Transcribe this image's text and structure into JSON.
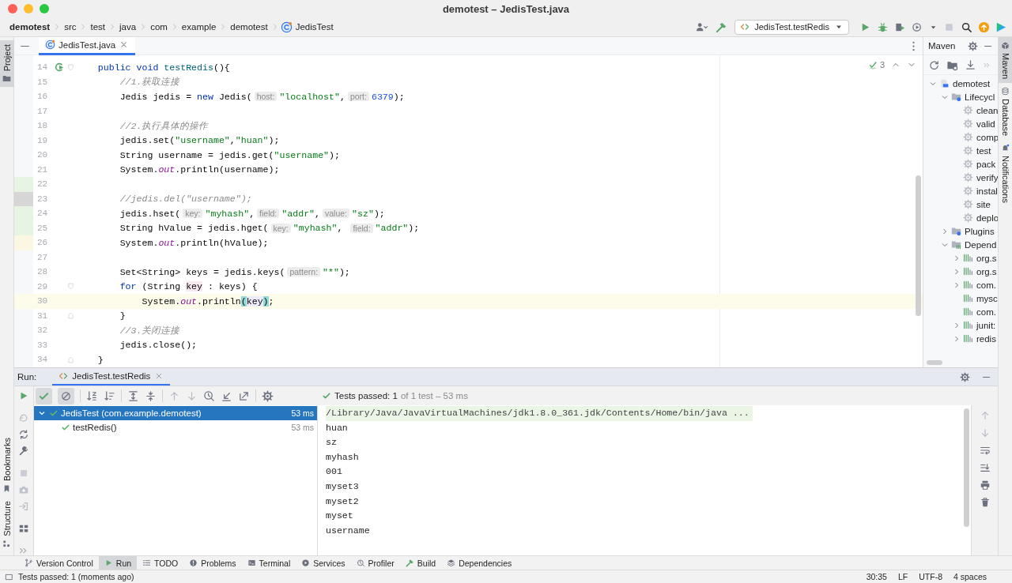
{
  "window": {
    "title": "demotest – JedisTest.java"
  },
  "breadcrumbs": [
    {
      "label": "demotest",
      "kind": "project"
    },
    {
      "label": "src",
      "kind": "folder"
    },
    {
      "label": "test",
      "kind": "folder"
    },
    {
      "label": "java",
      "kind": "folder"
    },
    {
      "label": "com",
      "kind": "folder"
    },
    {
      "label": "example",
      "kind": "folder"
    },
    {
      "label": "demotest",
      "kind": "folder"
    },
    {
      "label": "JedisTest",
      "kind": "class"
    }
  ],
  "run_config": {
    "label": "JedisTest.testRedis"
  },
  "left_stripe": [
    {
      "label": "Project",
      "selected": true
    },
    {
      "label": "Bookmarks",
      "selected": false
    },
    {
      "label": "Structure",
      "selected": false
    }
  ],
  "right_stripe": [
    {
      "label": "Maven",
      "selected": true
    },
    {
      "label": "Database",
      "selected": false
    },
    {
      "label": "Notifications",
      "selected": false
    }
  ],
  "editor": {
    "tabs": [
      {
        "label": "JedisTest.java",
        "selected": true
      }
    ],
    "inspection_count": "3",
    "lines": [
      {
        "number": "14",
        "current": false,
        "run_button": true,
        "fold_start": true,
        "tokens": [
          {
            "kind": "keyword",
            "text": "    public void"
          },
          {
            "kind": "method",
            "text": " testRedis"
          },
          {
            "kind": "plain",
            "text": "(){"
          }
        ]
      },
      {
        "number": "15",
        "current": false,
        "tokens": [
          {
            "kind": "comment",
            "text": "        //1.获取连接"
          }
        ]
      },
      {
        "number": "16",
        "current": false,
        "tokens": [
          {
            "kind": "plain",
            "text": "        Jedis jedis = "
          },
          {
            "kind": "keyword",
            "text": "new"
          },
          {
            "kind": "plain",
            "text": " Jedis("
          },
          {
            "kind": "hint",
            "text": "host:"
          },
          {
            "kind": "string",
            "text": "\"localhost\""
          },
          {
            "kind": "plain",
            "text": ","
          },
          {
            "kind": "hint",
            "text": "port:"
          },
          {
            "kind": "number",
            "text": "6379"
          },
          {
            "kind": "plain",
            "text": ");"
          }
        ]
      },
      {
        "number": "17",
        "current": false
      },
      {
        "number": "18",
        "current": false,
        "tokens": [
          {
            "kind": "comment",
            "text": "        //2.执行具体的操作"
          }
        ]
      },
      {
        "number": "19",
        "current": false,
        "tokens": [
          {
            "kind": "plain",
            "text": "        jedis.set("
          },
          {
            "kind": "string",
            "text": "\"username\""
          },
          {
            "kind": "plain",
            "text": ","
          },
          {
            "kind": "string",
            "text": "\"huan\""
          },
          {
            "kind": "plain",
            "text": ");"
          }
        ]
      },
      {
        "number": "20",
        "current": false,
        "tokens": [
          {
            "kind": "plain",
            "text": "        String username = jedis.get("
          },
          {
            "kind": "string",
            "text": "\"username\""
          },
          {
            "kind": "plain",
            "text": ");"
          }
        ]
      },
      {
        "number": "21",
        "current": false,
        "tokens": [
          {
            "kind": "plain",
            "text": "        System."
          },
          {
            "kind": "field",
            "text": "out"
          },
          {
            "kind": "plain",
            "text": ".println(username);"
          }
        ]
      },
      {
        "number": "22",
        "current": false,
        "added": true
      },
      {
        "number": "23",
        "current": false,
        "removed": true,
        "tokens": [
          {
            "kind": "comment",
            "text": "        //jedis.del(\"username\");"
          }
        ]
      },
      {
        "number": "24",
        "current": false,
        "added": true,
        "tokens": [
          {
            "kind": "plain",
            "text": "        jedis.hset("
          },
          {
            "kind": "hint",
            "text": "key:"
          },
          {
            "kind": "string",
            "text": "\"myhash\""
          },
          {
            "kind": "plain",
            "text": ","
          },
          {
            "kind": "hint",
            "text": "field:"
          },
          {
            "kind": "string",
            "text": "\"addr\""
          },
          {
            "kind": "plain",
            "text": ","
          },
          {
            "kind": "hint",
            "text": "value:"
          },
          {
            "kind": "string",
            "text": "\"sz\""
          },
          {
            "kind": "plain",
            "text": ");"
          }
        ]
      },
      {
        "number": "25",
        "current": false,
        "added": true,
        "tokens": [
          {
            "kind": "plain",
            "text": "        String hValue = jedis.hget("
          },
          {
            "kind": "hint",
            "text": "key:"
          },
          {
            "kind": "string",
            "text": "\"myhash\""
          },
          {
            "kind": "plain",
            "text": ", "
          },
          {
            "kind": "hint",
            "text": "field:"
          },
          {
            "kind": "string",
            "text": "\"addr\""
          },
          {
            "kind": "plain",
            "text": ");"
          }
        ]
      },
      {
        "number": "26",
        "current": false,
        "modified": true,
        "tokens": [
          {
            "kind": "plain",
            "text": "        System."
          },
          {
            "kind": "field",
            "text": "out"
          },
          {
            "kind": "plain",
            "text": ".println(hValue);"
          }
        ]
      },
      {
        "number": "27",
        "current": false
      },
      {
        "number": "28",
        "current": false,
        "tokens": [
          {
            "kind": "plain",
            "text": "        Set<String> keys = jedis.keys("
          },
          {
            "kind": "hint",
            "text": "pattern:"
          },
          {
            "kind": "string",
            "text": "\"*\""
          },
          {
            "kind": "plain",
            "text": ");"
          }
        ]
      },
      {
        "number": "29",
        "current": false,
        "fold_start": true,
        "tokens": [
          {
            "kind": "keyword",
            "text": "        for"
          },
          {
            "kind": "plain",
            "text": " (String "
          },
          {
            "kind": "declaration",
            "text": "key"
          },
          {
            "kind": "plain",
            "text": " : keys) {"
          }
        ]
      },
      {
        "number": "30",
        "current": true,
        "tokens": [
          {
            "kind": "plain",
            "text": "            System."
          },
          {
            "kind": "field",
            "text": "out"
          },
          {
            "kind": "plain",
            "text": ".println"
          },
          {
            "kind": "brace",
            "text": "("
          },
          {
            "kind": "usage",
            "text": "key"
          },
          {
            "kind": "brace",
            "text": ")"
          },
          {
            "kind": "plain",
            "text": ";"
          }
        ]
      },
      {
        "number": "31",
        "current": false,
        "fold_end": true,
        "tokens": [
          {
            "kind": "plain",
            "text": "        }"
          }
        ]
      },
      {
        "number": "32",
        "current": false,
        "tokens": [
          {
            "kind": "comment",
            "text": "        //3.关闭连接"
          }
        ]
      },
      {
        "number": "33",
        "current": false,
        "tokens": [
          {
            "kind": "plain",
            "text": "        jedis.close();"
          }
        ]
      },
      {
        "number": "34",
        "current": false,
        "fold_end": true,
        "tokens": [
          {
            "kind": "plain",
            "text": "    }"
          }
        ]
      }
    ]
  },
  "maven": {
    "title": "Maven",
    "tree": [
      {
        "label": "demotest",
        "kind": "project",
        "expanded": true,
        "children": [
          {
            "label": "Lifecycl",
            "kind": "lifecycle",
            "expanded": true,
            "children": [
              {
                "label": "clean",
                "kind": "goal"
              },
              {
                "label": "valid",
                "kind": "goal"
              },
              {
                "label": "comp",
                "kind": "goal"
              },
              {
                "label": "test",
                "kind": "goal"
              },
              {
                "label": "pack",
                "kind": "goal"
              },
              {
                "label": "verify",
                "kind": "goal"
              },
              {
                "label": "instal",
                "kind": "goal"
              },
              {
                "label": "site",
                "kind": "goal"
              },
              {
                "label": "deplo",
                "kind": "goal"
              }
            ]
          },
          {
            "label": "Plugins",
            "kind": "plugins",
            "expanded": false
          },
          {
            "label": "Depend",
            "kind": "dependencies",
            "expanded": true,
            "children": [
              {
                "label": "org.s",
                "kind": "library",
                "expanded": false
              },
              {
                "label": "org.s",
                "kind": "library",
                "expanded": false
              },
              {
                "label": "com.",
                "kind": "library",
                "expanded": false
              },
              {
                "label": "mysc",
                "kind": "library"
              },
              {
                "label": "com.",
                "kind": "library"
              },
              {
                "label": "junit:",
                "kind": "library",
                "expanded": false
              },
              {
                "label": "redis",
                "kind": "library",
                "expanded": false
              }
            ]
          }
        ]
      }
    ]
  },
  "run": {
    "label": "Run:",
    "tabs": [
      {
        "label": "JedisTest.testRedis",
        "selected": true
      }
    ],
    "summary": "Tests passed: 1",
    "summary_detail": "of 1 test – 53 ms",
    "tests": [
      {
        "label": "JedisTest (com.example.demotest)",
        "time": "53 ms",
        "selected": true,
        "expanded": true,
        "passed": true,
        "children": [
          {
            "label": "testRedis()",
            "time": "53 ms",
            "selected": false,
            "passed": true
          }
        ]
      }
    ],
    "console": [
      {
        "kind": "command",
        "text": "/Library/Java/JavaVirtualMachines/jdk1.8.0_361.jdk/Contents/Home/bin/java ..."
      },
      {
        "kind": "output",
        "text": "huan"
      },
      {
        "kind": "output",
        "text": "sz"
      },
      {
        "kind": "output",
        "text": "myhash"
      },
      {
        "kind": "output",
        "text": "001"
      },
      {
        "kind": "output",
        "text": "myset3"
      },
      {
        "kind": "output",
        "text": "myset2"
      },
      {
        "kind": "output",
        "text": "myset"
      },
      {
        "kind": "output",
        "text": "username"
      }
    ]
  },
  "tool_windows": [
    {
      "label": "Version Control",
      "selected": false
    },
    {
      "label": "Run",
      "selected": true
    },
    {
      "label": "TODO",
      "selected": false
    },
    {
      "label": "Problems",
      "selected": false
    },
    {
      "label": "Terminal",
      "selected": false
    },
    {
      "label": "Services",
      "selected": false
    },
    {
      "label": "Profiler",
      "selected": false
    },
    {
      "label": "Build",
      "selected": false
    },
    {
      "label": "Dependencies",
      "selected": false
    }
  ],
  "status_bar": {
    "message": "Tests passed: 1 (moments ago)",
    "position": "30:35",
    "line_separator": "LF",
    "encoding": "UTF-8",
    "indent": "4 spaces"
  }
}
